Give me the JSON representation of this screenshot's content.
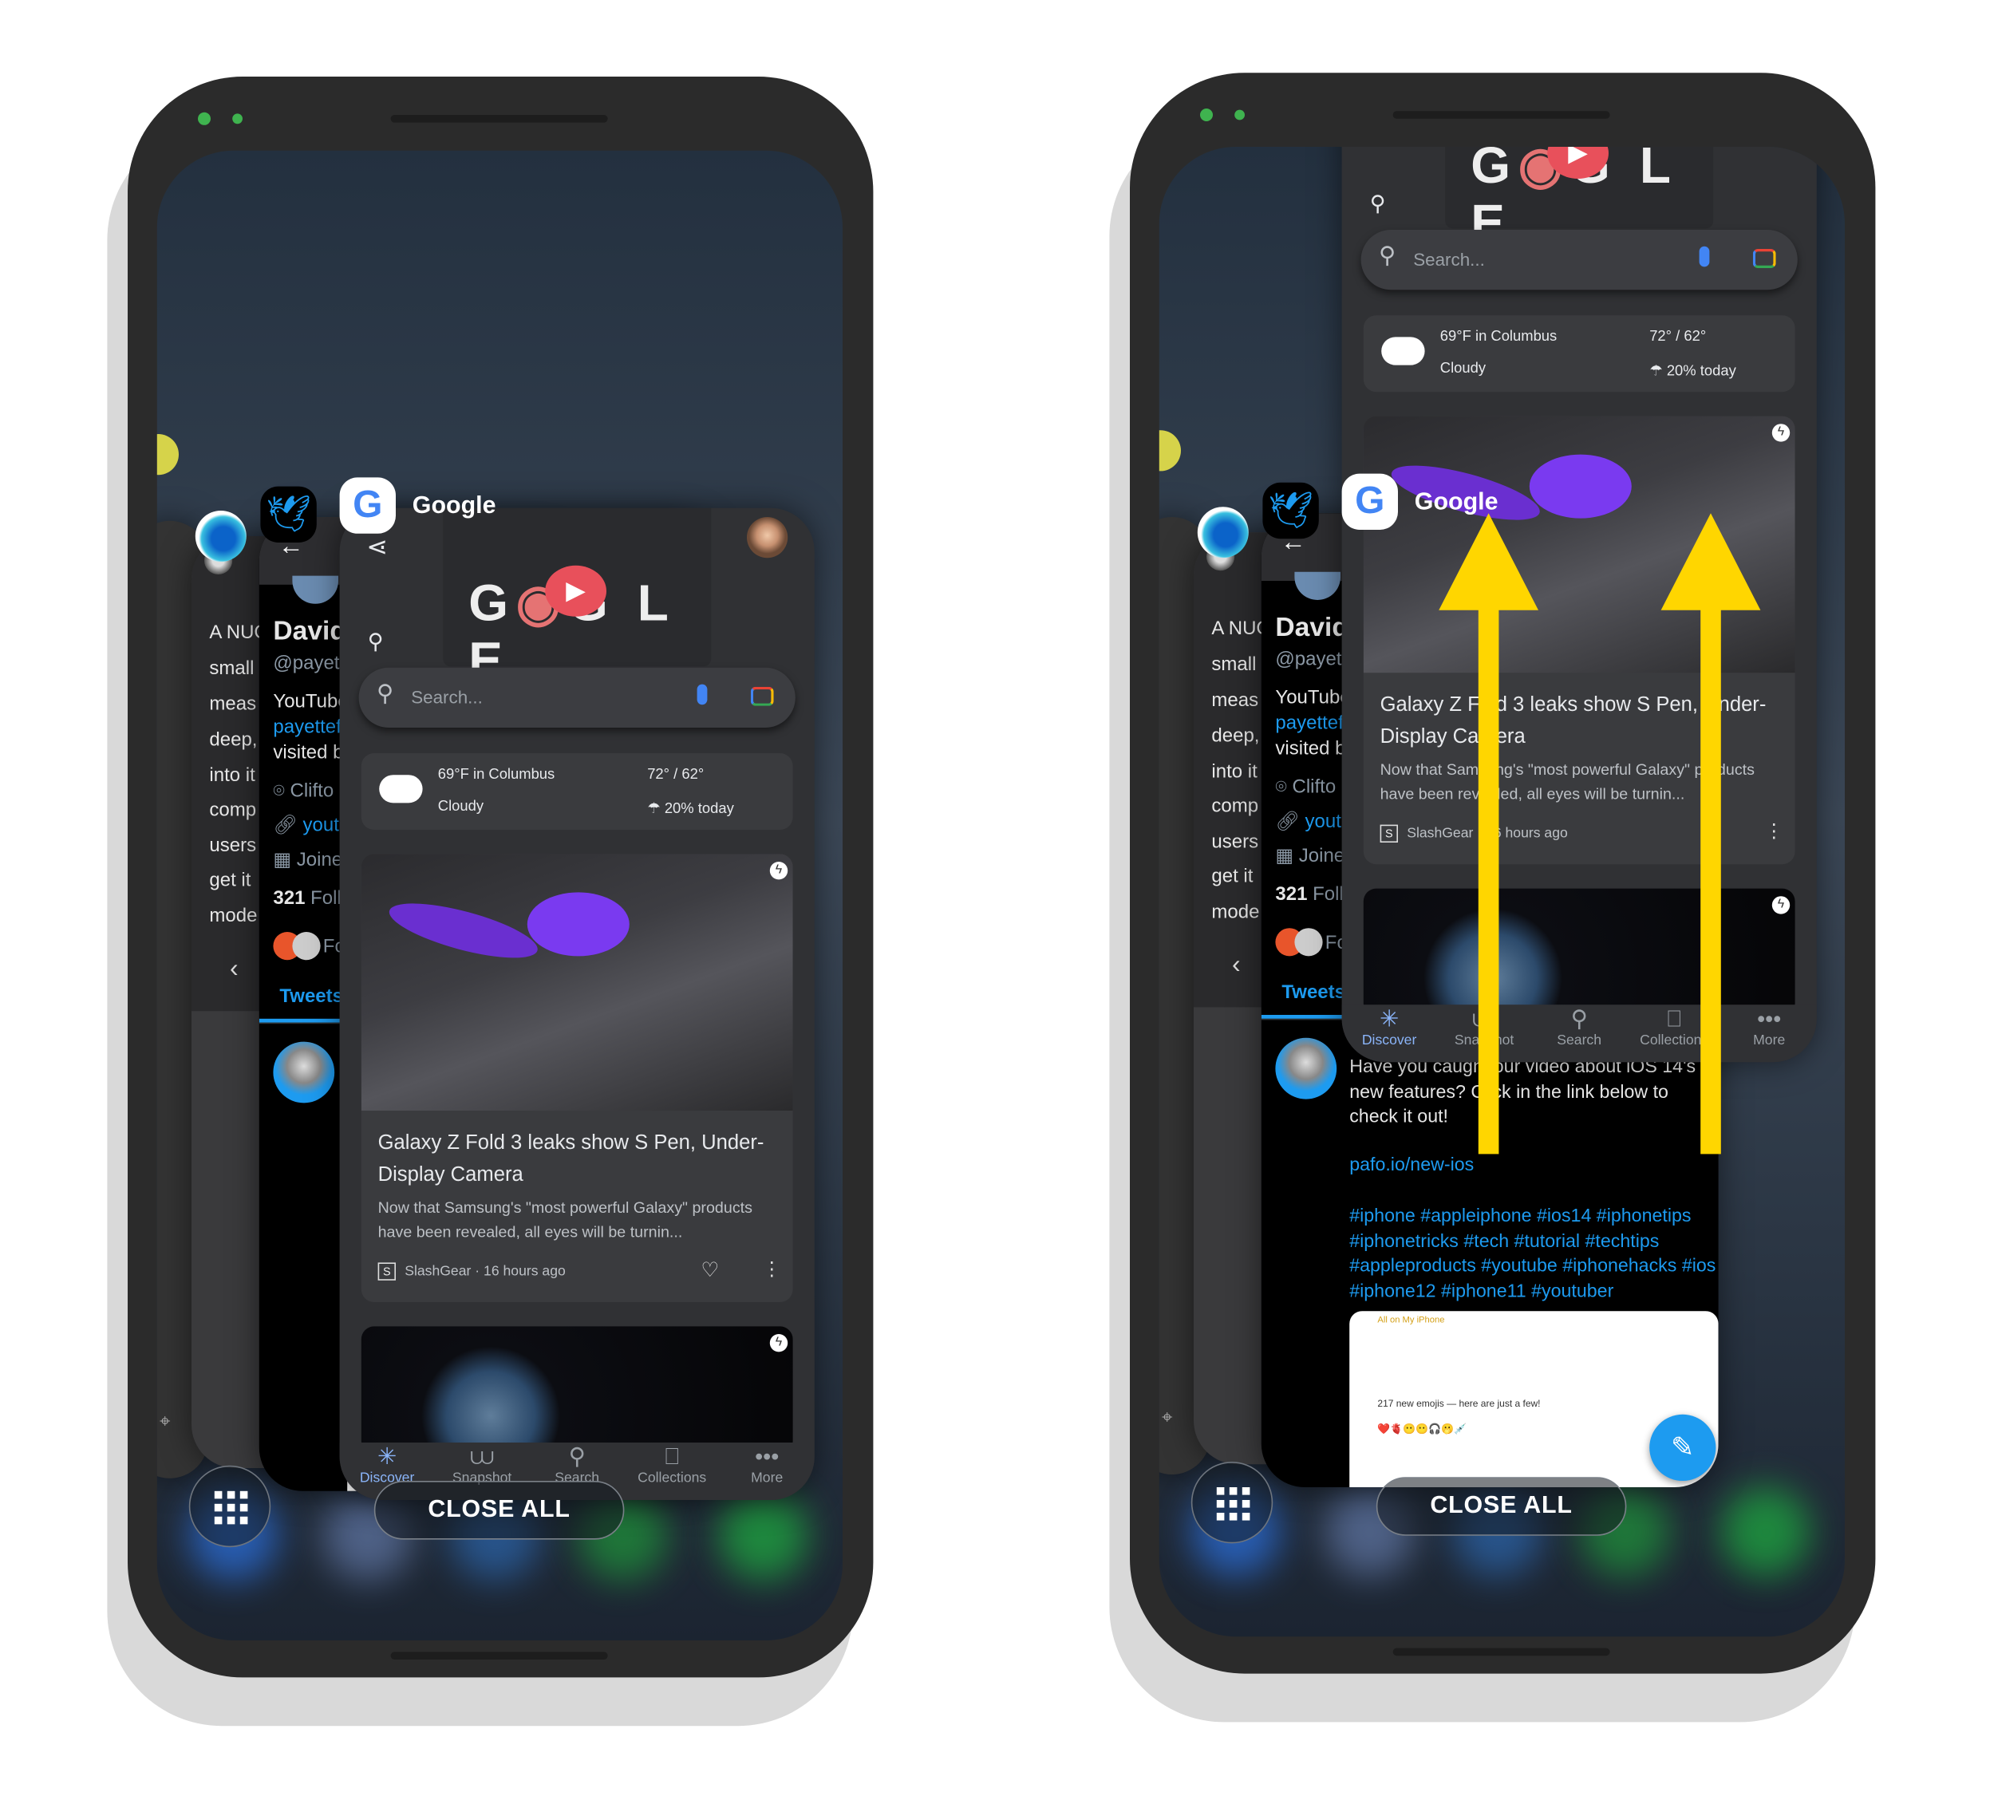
{
  "recents": {
    "google_label": "Google",
    "close_all_label": "CLOSE ALL",
    "apps": [
      "Snapchat",
      "Microsoft Edge",
      "Twitter",
      "Google"
    ]
  },
  "edge_card": {
    "lines": [
      "A NUC",
      "small",
      "meas",
      "deep,",
      "into it",
      "comp",
      "users",
      "get it",
      "mode"
    ]
  },
  "twitter_card": {
    "name": "David",
    "handle": "@payett",
    "bio_1": "YouTube",
    "bio_link": "payettef",
    "bio_2": "visited b",
    "location": "Clifto",
    "website": "youtu",
    "joined": "Joine",
    "followers_count": "321",
    "followers_label": "Foll",
    "followed_by": "Fo",
    "tab_tweets": "Tweets",
    "tweet_text": "Have you caught our video about iOS 14's new features? Click in the link below to check it out!",
    "tweet_link": "pafo.io/new-ios",
    "tweet_hashtags": "#iphone #appleiphone #ios14 #iphonetips #iphonetricks #tech #tutorial #techtips #appleproducts #youtube #iphonehacks #ios #iphone12 #iphone11 #youtuber",
    "media_back": "All on My iPhone",
    "media_text": "217 new emojis — here are just a few!",
    "media_emojis": "❤️🫀😶😶🎧🫢💉",
    "accent": "#1d9bf0"
  },
  "google_card": {
    "search_placeholder": "Search...",
    "weather": {
      "location": "69°F in Columbus",
      "condition": "Cloudy",
      "high_low": "72° / 62°",
      "precip": "20% today"
    },
    "article": {
      "title": "Galaxy Z Fold 3 leaks show S Pen, Under-Display Camera",
      "snippet": "Now that Samsung's \"most powerful Galaxy\" products have been revealed, all eyes will be turnin...",
      "source_initial": "S",
      "source": "SlashGear",
      "age": "16 hours ago"
    },
    "nav": [
      {
        "label": "Discover",
        "icon": "asterisk-icon",
        "active": true
      },
      {
        "label": "Snapshot",
        "icon": "snapshot-icon"
      },
      {
        "label": "Search",
        "icon": "search-icon"
      },
      {
        "label": "Collections",
        "icon": "bookmark-icon"
      },
      {
        "label": "More",
        "icon": "more-icon"
      }
    ],
    "accent": "#8ab4f8"
  },
  "annotation": {
    "arrow_color": "#ffd600",
    "direction": "up"
  }
}
